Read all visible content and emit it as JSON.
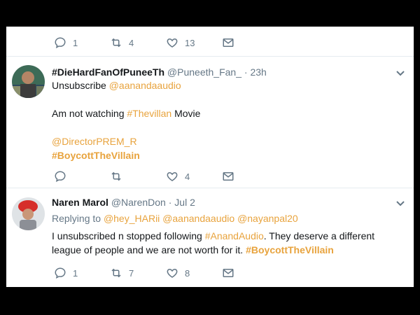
{
  "top_actions": {
    "reply_count": "1",
    "retweet_count": "4",
    "like_count": "13"
  },
  "tweet1": {
    "display_name": "#DieHardFanOfPuneeTh",
    "handle": "@Puneeth_Fan_",
    "separator": "·",
    "time": "23h",
    "unsubscribe_text": "Unsubscribe",
    "mention_aananda": "@aanandaaudio",
    "body_text": "Am not watching",
    "hashtag_villan": "#Thevillan",
    "body_text_end": "Movie",
    "mention_director": "@DirectorPREM_R",
    "hashtag_boycott": "#BoycottTheVillain",
    "actions": {
      "reply_count": "",
      "retweet_count": "",
      "like_count": "4"
    }
  },
  "tweet2": {
    "display_name": "Naren Marol",
    "handle": "@NarenDon",
    "separator": "·",
    "time": "Jul 2",
    "replying_to": "Replying to",
    "mention_hey": "@hey_HARii",
    "mention_aananda": "@aanandaaudio",
    "mention_nayan": "@nayanpal20",
    "body_part1": "I unsubscribed n stopped following",
    "hashtag_anand": "#AnandAudio",
    "body_part2": ". They deserve a different",
    "body_line2": "league of people and we are not worth for it.",
    "hashtag_boycott": "#BoycottTheVillain",
    "actions": {
      "reply_count": "1",
      "retweet_count": "7",
      "like_count": "8"
    }
  },
  "colors": {
    "link": "#e8a33d",
    "muted": "#657786",
    "text": "#14171a",
    "border": "#e6ecf0"
  }
}
